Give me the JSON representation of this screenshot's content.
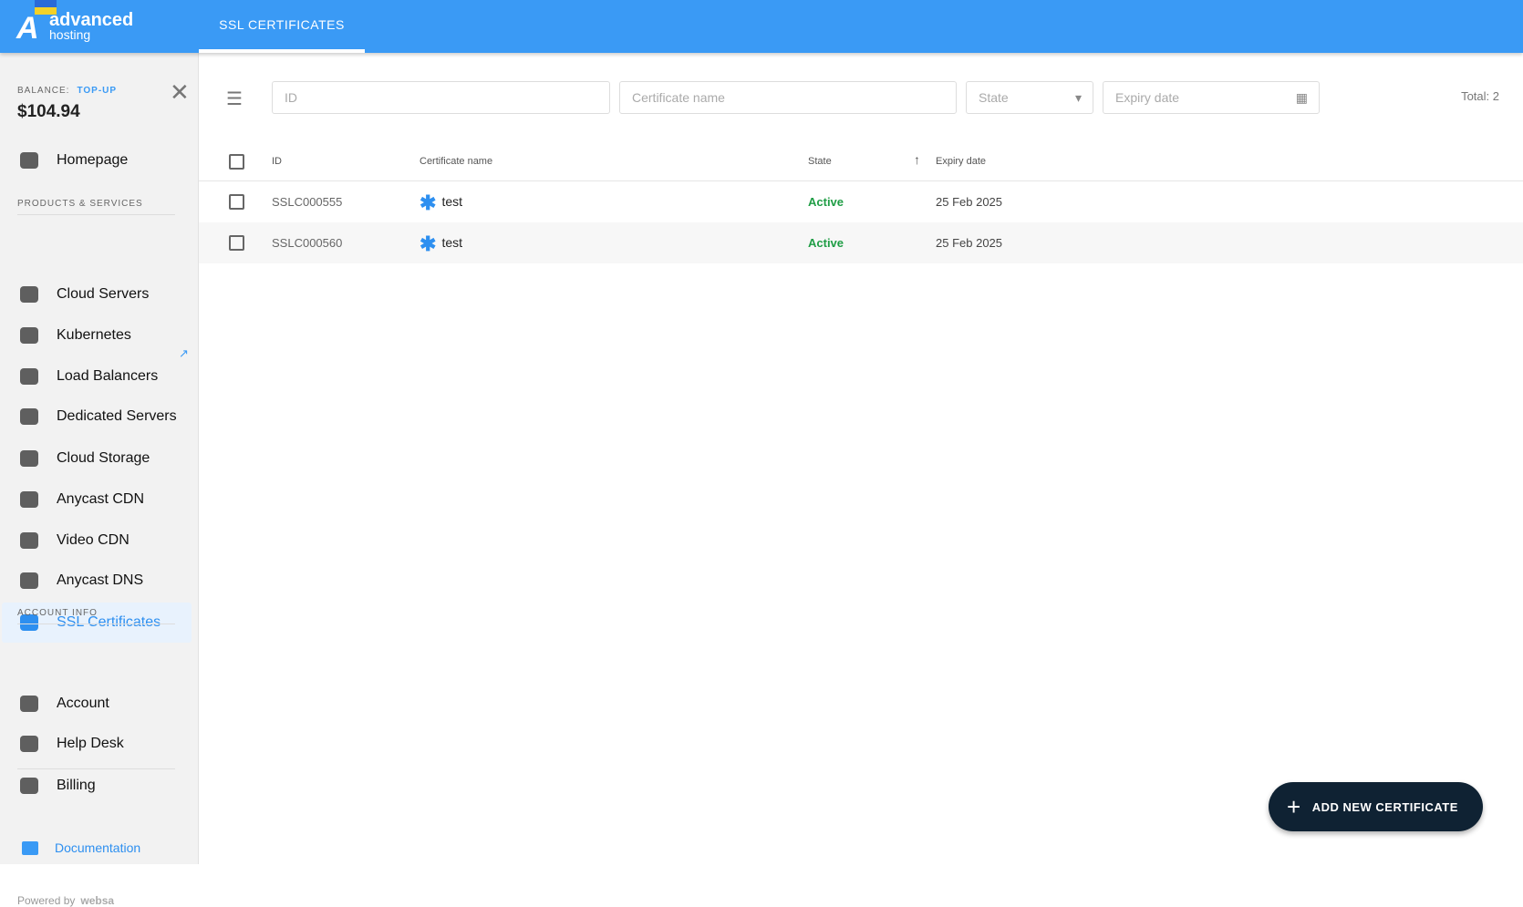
{
  "header": {
    "logo_line1": "advanced",
    "logo_line2": "hosting",
    "tab": "SSL CERTIFICATES"
  },
  "sidebar": {
    "balance_label": "BALANCE:",
    "topup": "TOP-UP",
    "balance": "$104.94",
    "home": "Homepage",
    "section_products": "PRODUCTS & SERVICES",
    "items": [
      {
        "label": "Cloud Servers",
        "icon": "server-stack-icon"
      },
      {
        "label": "Kubernetes",
        "icon": "kubernetes-icon"
      },
      {
        "label": "Load Balancers",
        "icon": "load-balancer-icon"
      },
      {
        "label": "Dedicated Servers",
        "icon": "dedicated-server-icon"
      },
      {
        "label": "Cloud Storage",
        "icon": "storage-icon"
      },
      {
        "label": "Anycast CDN",
        "icon": "cloud-cdn-icon"
      },
      {
        "label": "Video CDN",
        "icon": "video-cdn-icon"
      },
      {
        "label": "Anycast DNS",
        "icon": "dns-icon"
      },
      {
        "label": "SSL Certificates",
        "icon": "ssl-lock-icon"
      }
    ],
    "section_account": "ACCOUNT INFO",
    "account_items": [
      {
        "label": "Account",
        "icon": "users-icon"
      },
      {
        "label": "Help Desk",
        "icon": "chat-icon"
      },
      {
        "label": "Billing",
        "icon": "dollar-icon"
      }
    ],
    "documentation": "Documentation",
    "powered_by": "Powered by",
    "powered_brand": "websa"
  },
  "filters": {
    "id_placeholder": "ID",
    "name_placeholder": "Certificate name",
    "state_placeholder": "State",
    "expiry_placeholder": "Expiry date",
    "total": "Total: 2"
  },
  "table": {
    "headers": {
      "id": "ID",
      "name": "Certificate name",
      "state": "State",
      "expiry": "Expiry date"
    },
    "rows": [
      {
        "id": "SSLC000555",
        "name": "test",
        "state": "Active",
        "expiry": "25 Feb 2025"
      },
      {
        "id": "SSLC000560",
        "name": "test",
        "state": "Active",
        "expiry": "25 Feb 2025"
      }
    ]
  },
  "add_button": "ADD NEW CERTIFICATE",
  "colors": {
    "primary": "#3a9af5",
    "active": "#1f9d45",
    "fab": "#0f2233"
  }
}
